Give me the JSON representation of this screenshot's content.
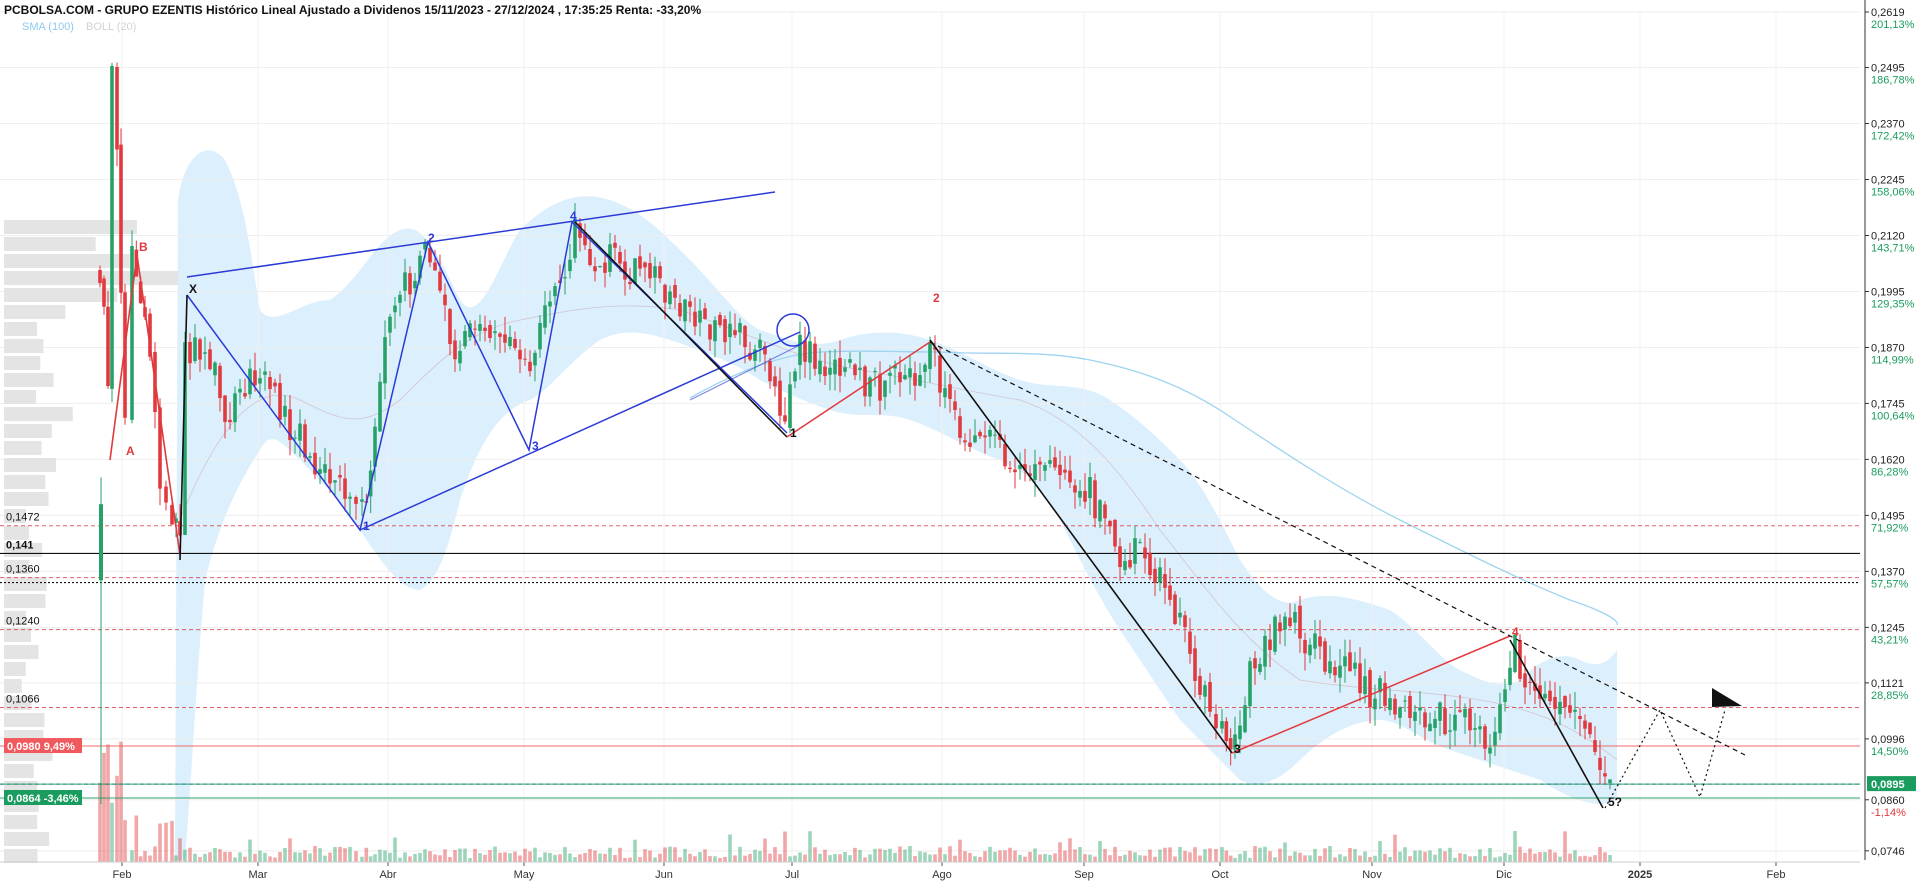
{
  "header": {
    "title": "PCBOLSA.COM - GRUPO EZENTIS Histórico Lineal Ajustado a Dividenos 15/11/2023 - 27/12/2024 , 17:35:25 Renta: -33,20%",
    "legend_sma": "SMA (100)",
    "legend_boll": "BOLL (20)"
  },
  "colors": {
    "up": "#26a269",
    "down": "#e0393e",
    "pattern_blue": "#2a3bd6",
    "pattern_red": "#e0393e",
    "band_fill": "#d6ecfb",
    "sma": "#9fd3f0",
    "green_tag": "#1a9c5e",
    "red_tag": "#f05a5e"
  },
  "chart_data": {
    "type": "candlestick",
    "y_range": [
      0.073,
      0.2619
    ],
    "right_axis_ticks": [
      {
        "price": "0,2619",
        "pct": "201,13%"
      },
      {
        "price": "0,2495",
        "pct": "186,78%"
      },
      {
        "price": "0,2370",
        "pct": "172,42%"
      },
      {
        "price": "0,2245",
        "pct": "158,06%"
      },
      {
        "price": "0,2120",
        "pct": "143,71%"
      },
      {
        "price": "0,1995",
        "pct": "129,35%"
      },
      {
        "price": "0,1870",
        "pct": "114,99%"
      },
      {
        "price": "0,1745",
        "pct": "100,64%"
      },
      {
        "price": "0,1620",
        "pct": "86,28%"
      },
      {
        "price": "0,1495",
        "pct": "71,92%"
      },
      {
        "price": "0,1370",
        "pct": "57,57%"
      },
      {
        "price": "0,1245",
        "pct": "43,21%"
      },
      {
        "price": "0,1121",
        "pct": "28,85%"
      },
      {
        "price": "0,0996",
        "pct": "14,50%"
      },
      {
        "price": "0,0860",
        "pct": "-1,14%"
      },
      {
        "price": "0,0746",
        "pct": ""
      }
    ],
    "months": [
      "Feb",
      "Mar",
      "Abr",
      "May",
      "Jun",
      "Jul",
      "Ago",
      "Sep",
      "Oct",
      "Nov",
      "Dic",
      "2025",
      "Feb"
    ],
    "levels": [
      {
        "label": "0,1472",
        "value": 0.1472,
        "style": "red-dash"
      },
      {
        "label": "0,141",
        "value": 0.141,
        "style": "black-solid"
      },
      {
        "label": "0,1360",
        "value": 0.1356,
        "style": "red-dash"
      },
      {
        "label": "",
        "value": 0.1345,
        "style": "black-dot"
      },
      {
        "label": "0,1240",
        "value": 0.124,
        "style": "red-dash"
      },
      {
        "label": "0,1066",
        "value": 0.1066,
        "style": "red-dash"
      },
      {
        "label": "",
        "value": 0.0895,
        "style": "blue-dash"
      }
    ],
    "tags": [
      {
        "label": "0,0980",
        "pct": "9,49%",
        "value": 0.098,
        "color": "red"
      },
      {
        "label": "0,0864",
        "pct": "-3,46%",
        "value": 0.0864,
        "color": "green"
      },
      {
        "label": "0,0895",
        "pct": "",
        "value": 0.0895,
        "color": "green",
        "side": "right"
      }
    ],
    "pattern_labels": {
      "x": "X",
      "a": "A",
      "b": "B",
      "w1": "1",
      "w2": "2",
      "w3": "3",
      "w4": "4",
      "e1": "1",
      "e2": "2",
      "e3": "3",
      "e4": "4",
      "e5": "5?"
    }
  }
}
